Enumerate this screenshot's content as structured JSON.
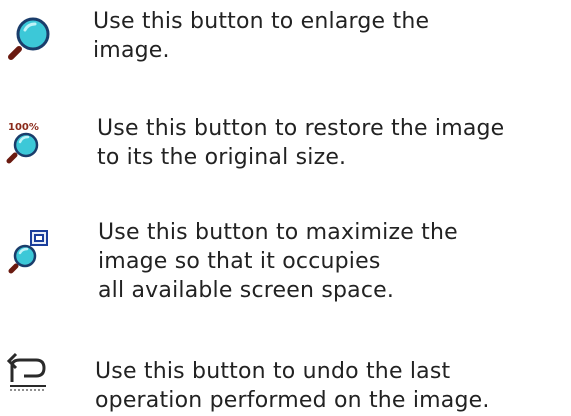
{
  "items": [
    {
      "icon": "magnifier-zoom-in-icon",
      "lines": [
        "Use this button to enlarge the",
        "image."
      ]
    },
    {
      "icon": "magnifier-100-percent-icon",
      "icon_text": "100%",
      "lines": [
        "Use this button to restore the image",
        "to its the original size."
      ]
    },
    {
      "icon": "magnifier-maximize-icon",
      "lines": [
        "Use this button to maximize the",
        "image so that it occupies",
        "all available screen space."
      ]
    },
    {
      "icon": "undo-arrow-icon",
      "lines": [
        "Use this button to undo the last",
        "operation performed on the image."
      ]
    }
  ],
  "colors": {
    "lens_fill": "#3cc8d8",
    "lens_rim": "#1a3d6b",
    "handle": "#6a1a10",
    "text": "#222222"
  }
}
